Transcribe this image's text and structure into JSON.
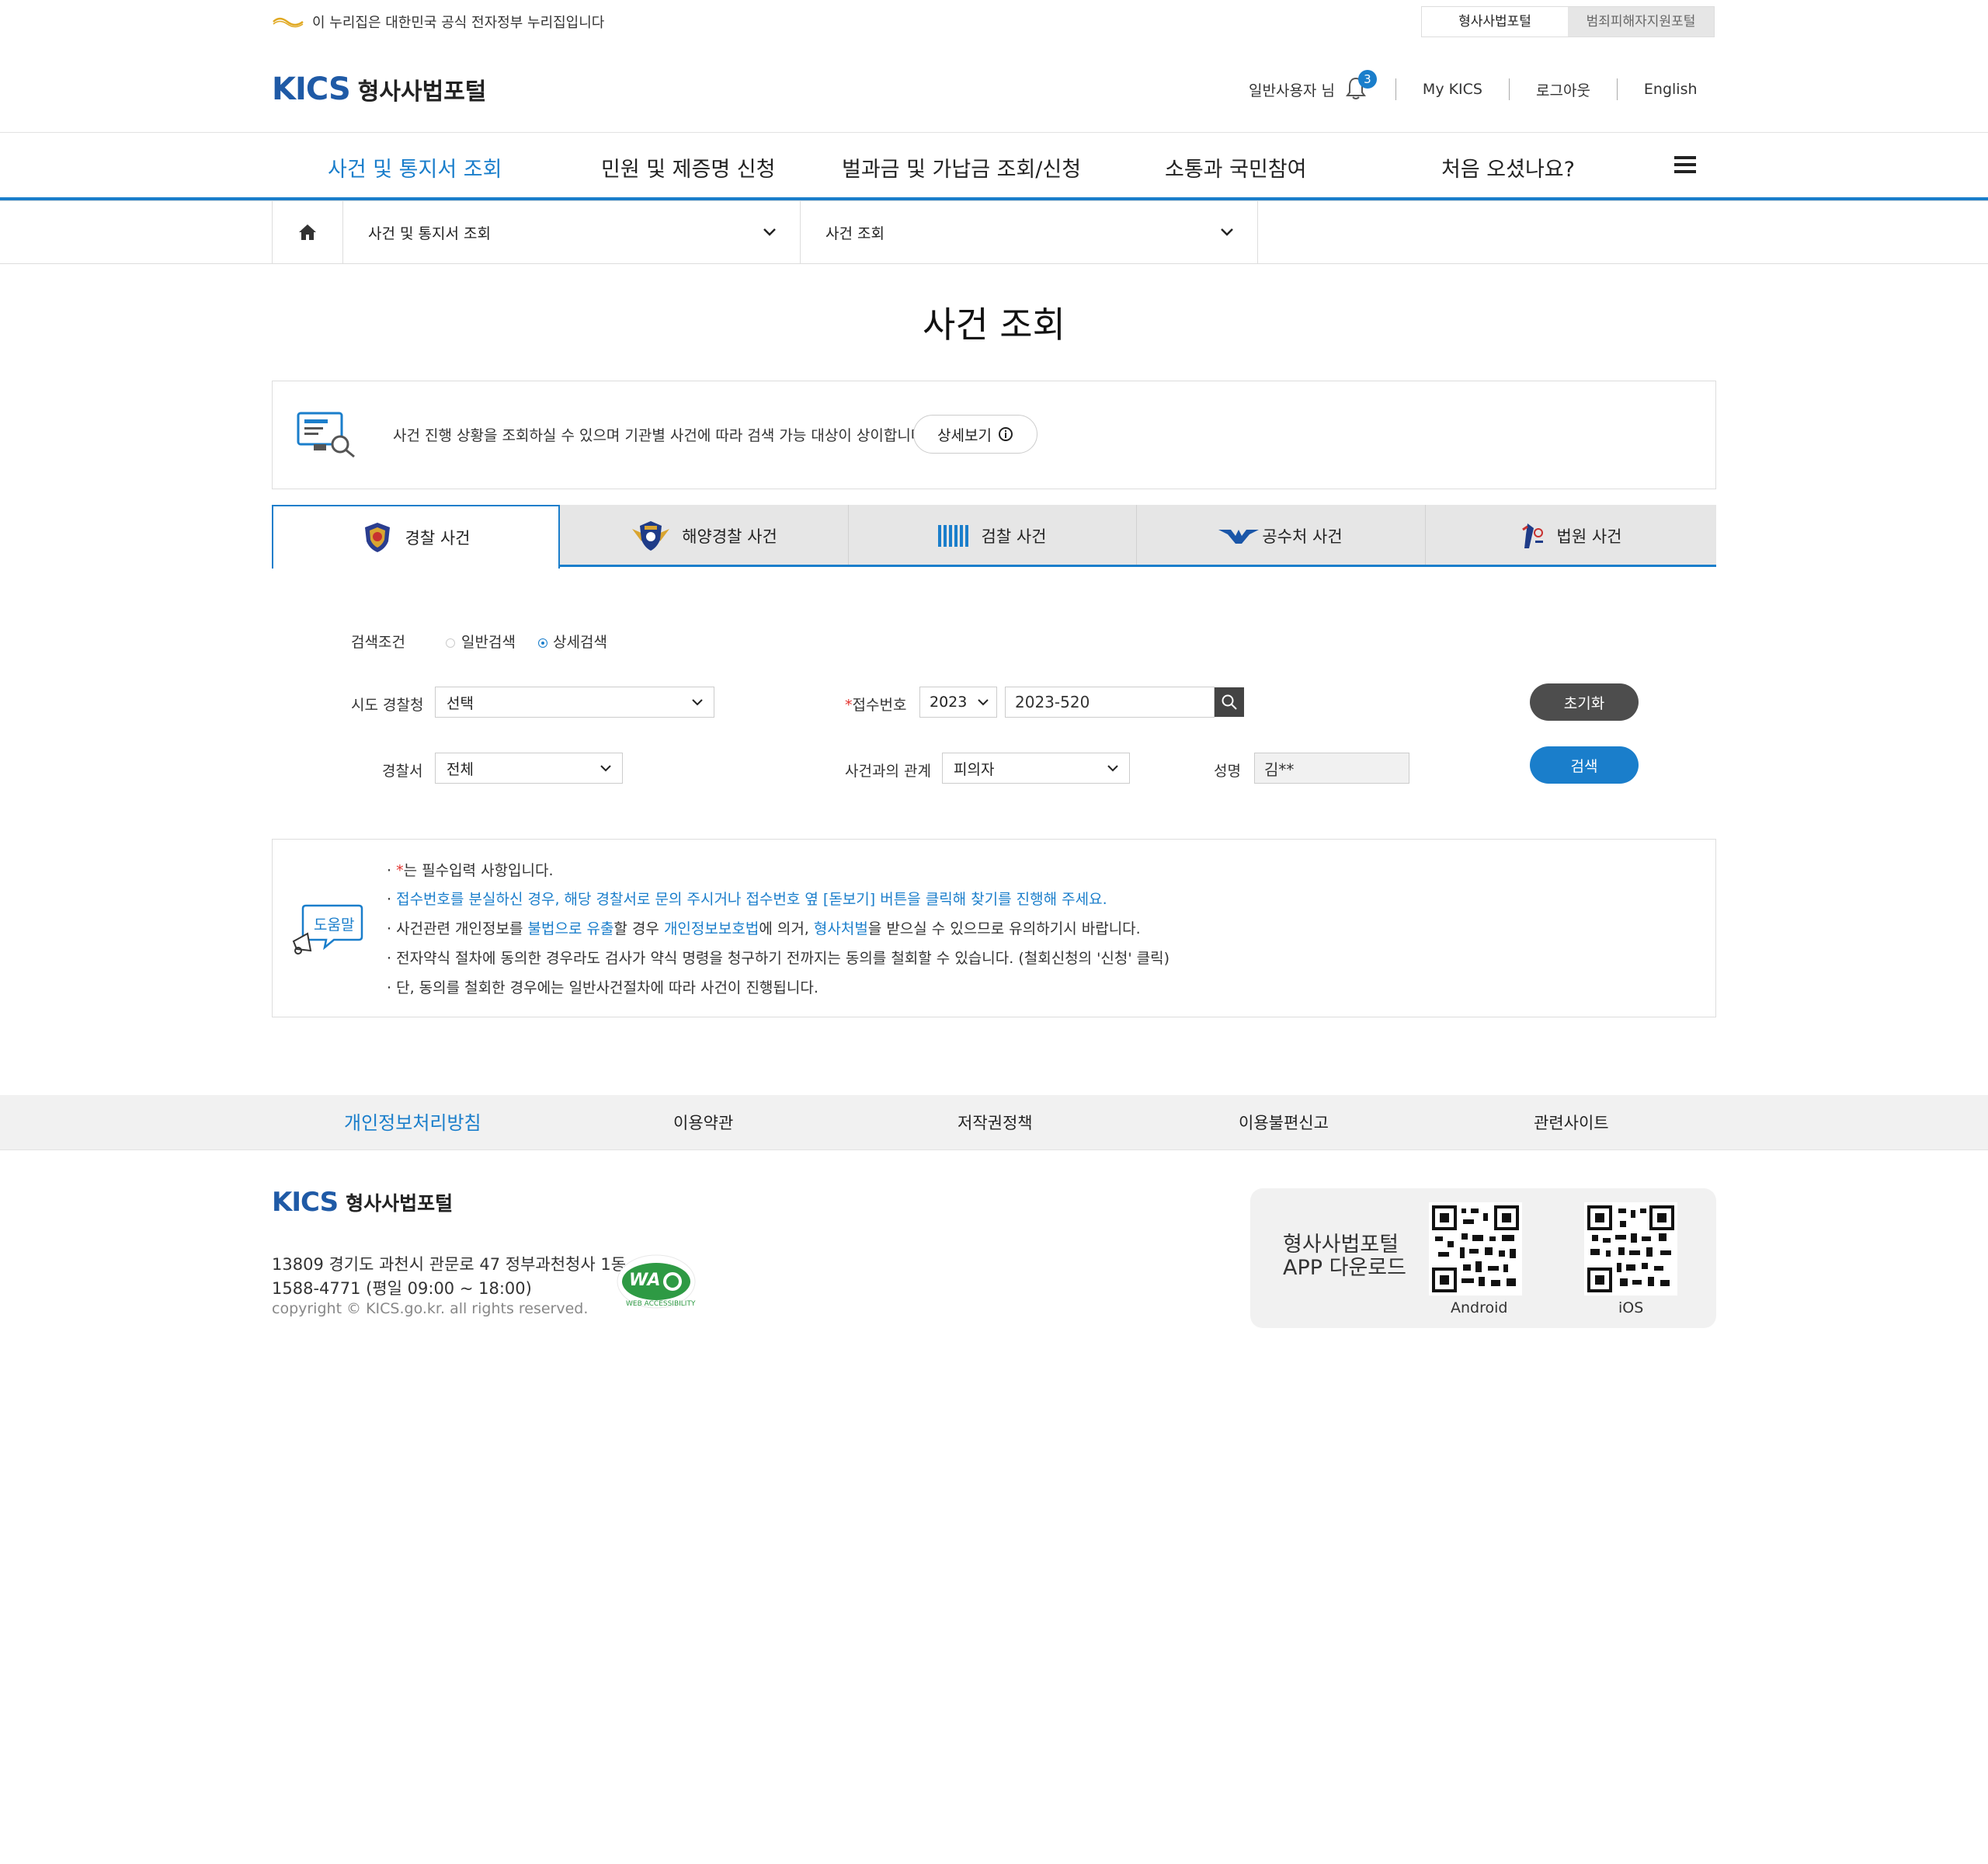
{
  "top_bar": {
    "gov_notice": "이 누리집은 대한민국 공식 전자정부 누리집입니다",
    "portal_tabs": [
      "형사사법포털",
      "범죄피해자지원포털"
    ]
  },
  "header": {
    "logo_mark": "KICS",
    "logo_text": "형사사법포털",
    "user": "일반사용자 님",
    "notification_count": "3",
    "links": [
      "My KICS",
      "로그아웃",
      "English"
    ]
  },
  "gnb": {
    "items": [
      "사건 및 통지서 조회",
      "민원 및 제증명 신청",
      "벌과금 및 가납금 조회/신청",
      "소통과 국민참여",
      "처음 오셨나요?"
    ]
  },
  "breadcrumb": {
    "level1": "사건 및 통지서 조회",
    "level2": "사건 조회"
  },
  "page_title": "사건 조회",
  "info": {
    "text": "사건 진행 상황을 조회하실 수 있으며 기관별 사건에 따라 검색 가능 대상이 상이합니다.",
    "detail_button": "상세보기"
  },
  "agency_tabs": [
    "경찰 사건",
    "해양경찰 사건",
    "검찰 사건",
    "공수처 사건",
    "법원 사건"
  ],
  "form": {
    "search_condition_label": "검색조건",
    "radio_options": [
      "일반검색",
      "상세검색"
    ],
    "sido_label": "시도 경찰청",
    "sido_value": "선택",
    "receipt_label": "접수번호",
    "required_mark": "*",
    "receipt_year": "2023",
    "receipt_no": "2023-520",
    "station_label": "경찰서",
    "station_value": "전체",
    "relation_label": "사건과의 관계",
    "relation_value": "피의자",
    "name_label": "성명",
    "name_value": "김**",
    "reset_button": "초기화",
    "search_button": "검색"
  },
  "help": {
    "badge": "도움말",
    "line1_mark": "*",
    "line1_text": "는 필수입력 사항입니다.",
    "line2": "접수번호를 분실하신 경우, 해당 경찰서로 문의 주시거나 접수번호 옆 [돋보기] 버튼을 클릭해 찾기를 진행해 주세요.",
    "line3_a": "사건관련 개인정보를 ",
    "line3_b": "불법으로 유출",
    "line3_c": "할 경우 ",
    "line3_d": "개인정보보호법",
    "line3_e": "에 의거, ",
    "line3_f": "형사처벌",
    "line3_g": "을 받으실 수 있으므로 유의하기시 바랍니다.",
    "line4": "전자약식 절차에 동의한 경우라도 검사가 약식 명령을 청구하기 전까지는 동의를 철회할 수 있습니다. (철회신청의 '신청' 클릭)",
    "line5": "단, 동의를 철회한 경우에는 일반사건절차에 따라 사건이 진행됩니다."
  },
  "footer": {
    "links": [
      "개인정보처리방침",
      "이용약관",
      "저작권정책",
      "이용불편신고",
      "관련사이트"
    ],
    "logo_mark": "KICS",
    "logo_text": "형사사법포털",
    "address": "13809  경기도 과천시 관문로 47 정부과천청사 1동",
    "phone": "1588-4771 (평일 09:00 ~ 18:00)",
    "copyright": "copyright © KICS.go.kr. all rights reserved.",
    "wa_mark": "WA",
    "wa_caption": "WEB ACCESSIBILITY",
    "app_line1": "형사사법포털",
    "app_line2": "APP 다운로드",
    "qr_android": "Android",
    "qr_ios": "iOS"
  },
  "colors": {
    "accent": "#1a7ecb",
    "brand": "#1f5aa6",
    "required": "#e3342f"
  }
}
